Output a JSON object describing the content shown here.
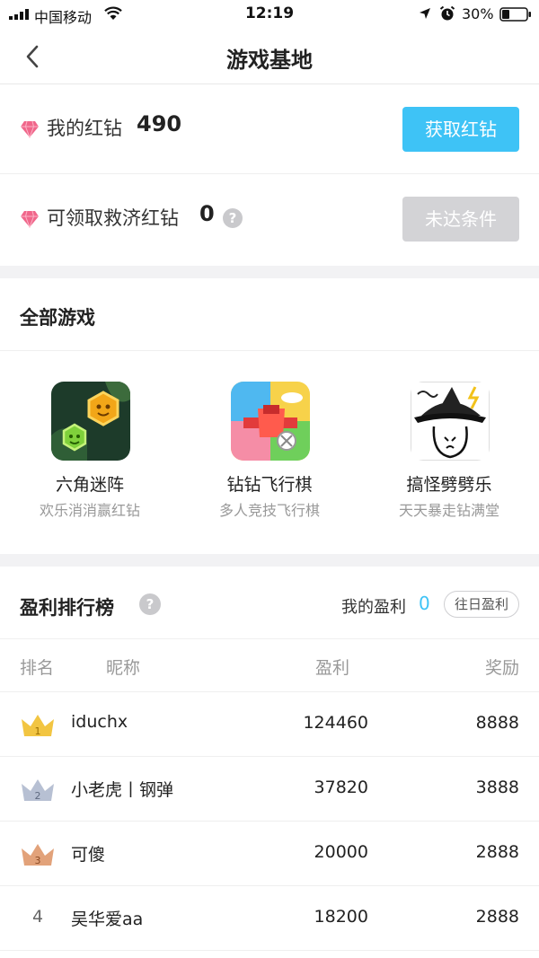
{
  "status_bar": {
    "carrier": "中国移动",
    "time": "12:19",
    "battery": "30%",
    "icons": [
      "signal-icon",
      "wifi-icon",
      "location-icon",
      "alarm-icon",
      "battery-icon"
    ]
  },
  "nav": {
    "title": "游戏基地",
    "back_icon": "chevron-left-icon"
  },
  "wallet": {
    "red_diamond_label": "我的红钻",
    "red_diamond_value": "490",
    "get_button": "获取红钻",
    "relief_label": "可领取救济红钻",
    "relief_value": "0",
    "relief_help": "?",
    "relief_button": "未达条件",
    "gem_color": "#f0668a"
  },
  "games": {
    "title": "全部游戏",
    "items": [
      {
        "name": "六角迷阵",
        "desc": "欢乐消消赢红钻"
      },
      {
        "name": "钻钻飞行棋",
        "desc": "多人竞技飞行棋"
      },
      {
        "name": "搞怪劈劈乐",
        "desc": "天天暴走钻满堂"
      }
    ]
  },
  "leaderboard": {
    "title": "盈利排行榜",
    "help": "?",
    "my_profit_label": "我的盈利",
    "my_profit_value": "0",
    "history_button": "往日盈利",
    "columns": {
      "rank": "排名",
      "nickname": "昵称",
      "profit": "盈利",
      "reward": "奖励"
    },
    "rows": [
      {
        "rank": "1",
        "nickname": "iduchx",
        "profit": "124460",
        "reward": "8888"
      },
      {
        "rank": "2",
        "nickname": "小老虎丨钢弹",
        "profit": "37820",
        "reward": "3888"
      },
      {
        "rank": "3",
        "nickname": "可傻",
        "profit": "20000",
        "reward": "2888"
      },
      {
        "rank": "4",
        "nickname": "吴华爱aa",
        "profit": "18200",
        "reward": "2888"
      }
    ]
  },
  "colors": {
    "accent_blue": "#3ec3f6",
    "disabled_gray": "#d3d3d6",
    "gold": "#f2c542",
    "silver": "#b7c0d3",
    "bronze": "#e2a27a"
  }
}
